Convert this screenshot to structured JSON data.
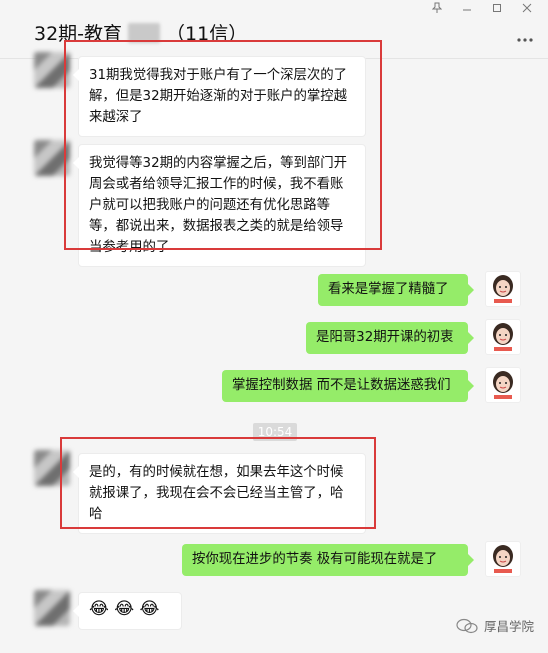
{
  "window": {
    "title_prefix": "32期-教育",
    "title_count": "（11信）"
  },
  "timestamp": "10:54",
  "messages": [
    {
      "side": "left",
      "text": "31期我觉得我对于账户有了一个深层次的了解，但是32期开始逐渐的对于账户的掌控越来越深了"
    },
    {
      "side": "left",
      "text": "我觉得等32期的内容掌握之后，等到部门开周会或者给领导汇报工作的时候，我不看账户就可以把我账户的问题还有优化思路等等，都说出来，数据报表之类的就是给领导当参考用的了"
    },
    {
      "side": "right",
      "text": "看来是掌握了精髓了"
    },
    {
      "side": "right",
      "text": "是阳哥32期开课的初衷"
    },
    {
      "side": "right",
      "text": "掌握控制数据  而不是让数据迷惑我们"
    },
    {
      "side": "left",
      "text": "是的，有的时候就在想，如果去年这个时候就报课了，我现在会不会已经当主管了，哈哈"
    },
    {
      "side": "right",
      "text": "按你现在进步的节奏  极有可能现在就是了"
    },
    {
      "side": "left",
      "text": "😂 😂 😂"
    }
  ],
  "watermark": {
    "text": "厚昌学院"
  },
  "colors": {
    "sent_bubble": "#95ec69",
    "received_bubble": "#ffffff",
    "highlight": "#d93a3a"
  },
  "icons": [
    "pin-icon",
    "minimize-icon",
    "maximize-icon",
    "close-icon",
    "more-icon"
  ]
}
